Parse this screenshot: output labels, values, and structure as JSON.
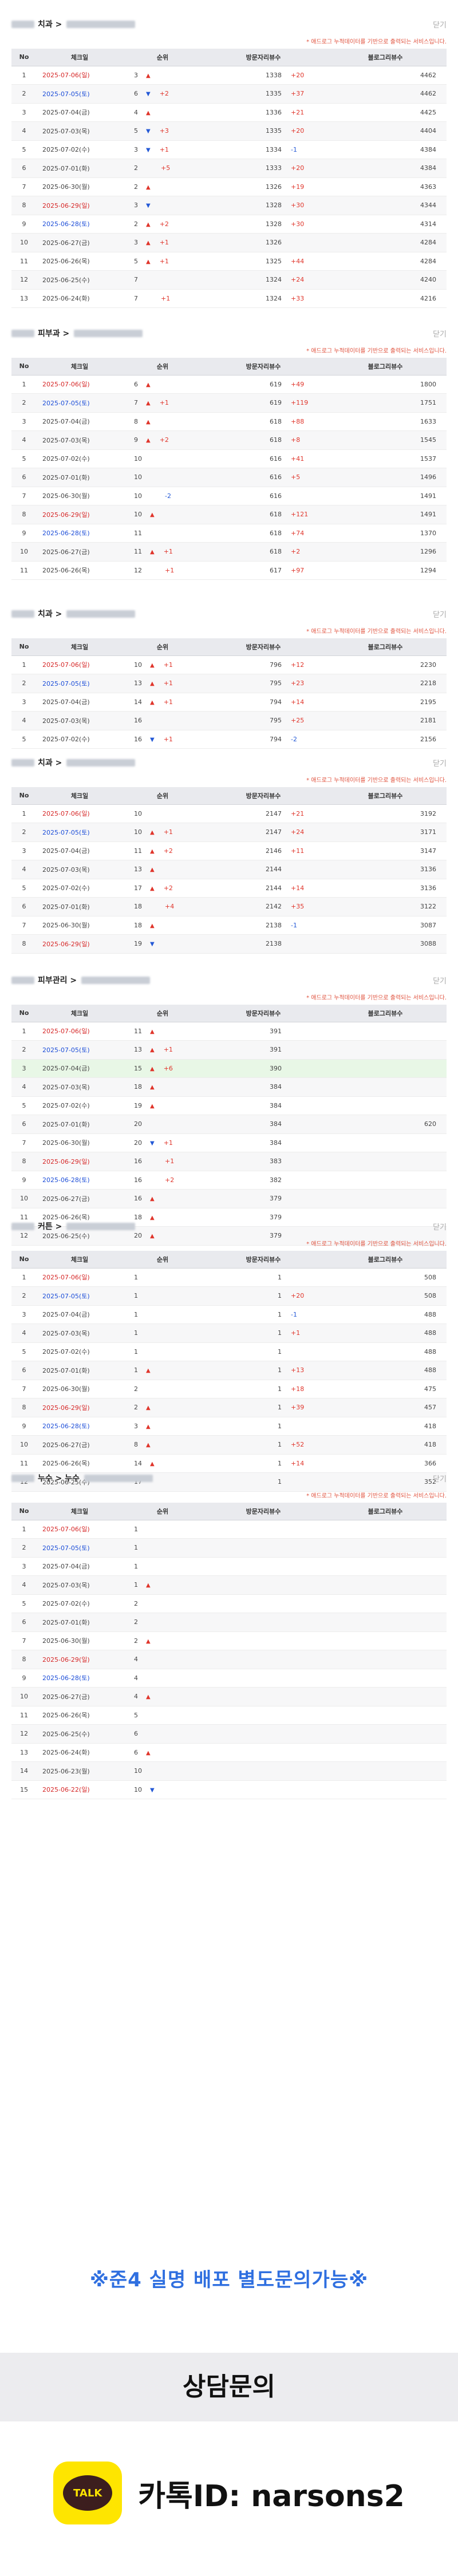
{
  "common": {
    "close": "닫기",
    "note": "* 애드로그 누적데이터를 기반으로 출력되는 서비스입니다.",
    "headers": [
      "No",
      "체크일",
      "순위",
      "방문자리뷰수",
      "블로그리뷰수"
    ]
  },
  "panels": [
    {
      "title_suffix": "치과 >",
      "rows": [
        [
          "1",
          "2025-07-06(일)",
          "3",
          "up",
          "",
          "1338",
          "+20",
          "4462"
        ],
        [
          "2",
          "2025-07-05(토)",
          "6",
          "dn",
          "+2",
          "1335",
          "+37",
          "4462"
        ],
        [
          "3",
          "2025-07-04(금)",
          "4",
          "up",
          "",
          "1336",
          "+21",
          "4425"
        ],
        [
          "4",
          "2025-07-03(목)",
          "5",
          "dn",
          "+3",
          "1335",
          "+20",
          "4404"
        ],
        [
          "5",
          "2025-07-02(수)",
          "3",
          "dn",
          "+1",
          "1334",
          "-1",
          "4384"
        ],
        [
          "6",
          "2025-07-01(화)",
          "2",
          "",
          "+5",
          "1333",
          "+20",
          "4384"
        ],
        [
          "7",
          "2025-06-30(월)",
          "2",
          "up",
          "",
          "1326",
          "+19",
          "4363"
        ],
        [
          "8",
          "2025-06-29(일)",
          "3",
          "dn",
          "",
          "1328",
          "+30",
          "4344"
        ],
        [
          "9",
          "2025-06-28(토)",
          "2",
          "up",
          "+2",
          "1328",
          "+30",
          "4314"
        ],
        [
          "10",
          "2025-06-27(금)",
          "3",
          "up",
          "+1",
          "1326",
          "",
          "4284"
        ],
        [
          "11",
          "2025-06-26(목)",
          "5",
          "up",
          "+1",
          "1325",
          "+44",
          "4284"
        ],
        [
          "12",
          "2025-06-25(수)",
          "7",
          "",
          "",
          "1324",
          "+24",
          "4240"
        ],
        [
          "13",
          "2025-06-24(화)",
          "7",
          "",
          "+1",
          "1324",
          "+33",
          "4216"
        ]
      ]
    },
    {
      "title_suffix": "피부과 >",
      "rows": [
        [
          "1",
          "2025-07-06(일)",
          "6",
          "up",
          "",
          "619",
          "+49",
          "1800"
        ],
        [
          "2",
          "2025-07-05(토)",
          "7",
          "up",
          "+1",
          "619",
          "+119",
          "1751"
        ],
        [
          "3",
          "2025-07-04(금)",
          "8",
          "up",
          "",
          "618",
          "+88",
          "1633"
        ],
        [
          "4",
          "2025-07-03(목)",
          "9",
          "up",
          "+2",
          "618",
          "+8",
          "1545"
        ],
        [
          "5",
          "2025-07-02(수)",
          "10",
          "",
          "",
          "616",
          "+41",
          "1537"
        ],
        [
          "6",
          "2025-07-01(화)",
          "10",
          "",
          "",
          "616",
          "+5",
          "1496"
        ],
        [
          "7",
          "2025-06-30(월)",
          "10",
          "",
          "-2",
          "616",
          "",
          "1491"
        ],
        [
          "8",
          "2025-06-29(일)",
          "10",
          "up",
          "",
          "618",
          "+121",
          "1491"
        ],
        [
          "9",
          "2025-06-28(토)",
          "11",
          "",
          "",
          "618",
          "+74",
          "1370"
        ],
        [
          "10",
          "2025-06-27(금)",
          "11",
          "up",
          "+1",
          "618",
          "+2",
          "1296"
        ],
        [
          "11",
          "2025-06-26(목)",
          "12",
          "",
          "+1",
          "617",
          "+97",
          "1294"
        ]
      ]
    },
    {
      "title_suffix": "치과 >",
      "rows": [
        [
          "1",
          "2025-07-06(일)",
          "10",
          "up",
          "+1",
          "796",
          "+12",
          "2230"
        ],
        [
          "2",
          "2025-07-05(토)",
          "13",
          "up",
          "+1",
          "795",
          "+23",
          "2218"
        ],
        [
          "3",
          "2025-07-04(금)",
          "14",
          "up",
          "+1",
          "794",
          "+14",
          "2195"
        ],
        [
          "4",
          "2025-07-03(목)",
          "16",
          "",
          "",
          "795",
          "+25",
          "2181"
        ],
        [
          "5",
          "2025-07-02(수)",
          "16",
          "dn",
          "+1",
          "794",
          "-2",
          "2156"
        ]
      ]
    },
    {
      "title_suffix": "치과 >",
      "rows": [
        [
          "1",
          "2025-07-06(일)",
          "10",
          "",
          "",
          "2147",
          "+21",
          "3192"
        ],
        [
          "2",
          "2025-07-05(토)",
          "10",
          "up",
          "+1",
          "2147",
          "+24",
          "3171"
        ],
        [
          "3",
          "2025-07-04(금)",
          "11",
          "up",
          "+2",
          "2146",
          "+11",
          "3147"
        ],
        [
          "4",
          "2025-07-03(목)",
          "13",
          "up",
          "",
          "2144",
          "",
          "3136"
        ],
        [
          "5",
          "2025-07-02(수)",
          "17",
          "up",
          "+2",
          "2144",
          "+14",
          "3136"
        ],
        [
          "6",
          "2025-07-01(화)",
          "18",
          "",
          "+4",
          "2142",
          "+35",
          "3122"
        ],
        [
          "7",
          "2025-06-30(월)",
          "18",
          "up",
          "",
          "2138",
          "-1",
          "3087"
        ],
        [
          "8",
          "2025-06-29(일)",
          "19",
          "dn",
          "",
          "2138",
          "",
          "3088"
        ]
      ]
    },
    {
      "title_suffix": "피부관리 >",
      "rows": [
        [
          "1",
          "2025-07-06(일)",
          "11",
          "up",
          "",
          "391",
          "",
          ""
        ],
        [
          "2",
          "2025-07-05(토)",
          "13",
          "up",
          "+1",
          "391",
          "",
          ""
        ],
        [
          "3",
          "2025-07-04(금)",
          "15",
          "up",
          "+6",
          "390",
          "",
          ""
        ],
        [
          "4",
          "2025-07-03(목)",
          "18",
          "up",
          "",
          "384",
          "",
          ""
        ],
        [
          "5",
          "2025-07-02(수)",
          "19",
          "up",
          "",
          "384",
          "",
          ""
        ],
        [
          "6",
          "2025-07-01(화)",
          "20",
          "",
          "",
          "384",
          "",
          "620"
        ],
        [
          "7",
          "2025-06-30(월)",
          "20",
          "dn",
          "+1",
          "384",
          "",
          ""
        ],
        [
          "8",
          "2025-06-29(일)",
          "16",
          "",
          "+1",
          "383",
          "",
          ""
        ],
        [
          "9",
          "2025-06-28(토)",
          "16",
          "",
          "+2",
          "382",
          "",
          ""
        ],
        [
          "10",
          "2025-06-27(금)",
          "16",
          "up",
          "",
          "379",
          "",
          ""
        ],
        [
          "11",
          "2025-06-26(목)",
          "18",
          "up",
          "",
          "379",
          "",
          ""
        ],
        [
          "12",
          "2025-06-25(수)",
          "20",
          "up",
          "",
          "379",
          "",
          ""
        ]
      ]
    },
    {
      "title_suffix": "커튼 >",
      "rows": [
        [
          "1",
          "2025-07-06(일)",
          "1",
          "",
          "",
          "1",
          "",
          "508"
        ],
        [
          "2",
          "2025-07-05(토)",
          "1",
          "",
          "",
          "1",
          "+20",
          "508"
        ],
        [
          "3",
          "2025-07-04(금)",
          "1",
          "",
          "",
          "1",
          "-1",
          "488"
        ],
        [
          "4",
          "2025-07-03(목)",
          "1",
          "",
          "",
          "1",
          "+1",
          "488"
        ],
        [
          "5",
          "2025-07-02(수)",
          "1",
          "",
          "",
          "1",
          "",
          "488"
        ],
        [
          "6",
          "2025-07-01(화)",
          "1",
          "up",
          "",
          "1",
          "+13",
          "488"
        ],
        [
          "7",
          "2025-06-30(월)",
          "2",
          "",
          "",
          "1",
          "+18",
          "475"
        ],
        [
          "8",
          "2025-06-29(일)",
          "2",
          "up",
          "",
          "1",
          "+39",
          "457"
        ],
        [
          "9",
          "2025-06-28(토)",
          "3",
          "up",
          "",
          "1",
          "",
          "418"
        ],
        [
          "10",
          "2025-06-27(금)",
          "8",
          "up",
          "",
          "1",
          "+52",
          "418"
        ],
        [
          "11",
          "2025-06-26(목)",
          "14",
          "up",
          "",
          "1",
          "+14",
          "366"
        ],
        [
          "12",
          "2025-06-25(수)",
          "17",
          "",
          "",
          "1",
          "",
          "352"
        ]
      ]
    },
    {
      "title_suffix": "누수 > 누수",
      "rows": [
        [
          "1",
          "2025-07-06(일)",
          "1",
          "",
          "",
          "",
          "",
          ""
        ],
        [
          "2",
          "2025-07-05(토)",
          "1",
          "",
          "",
          "",
          "",
          ""
        ],
        [
          "3",
          "2025-07-04(금)",
          "1",
          "",
          "",
          "",
          "",
          ""
        ],
        [
          "4",
          "2025-07-03(목)",
          "1",
          "up",
          "",
          "",
          "",
          ""
        ],
        [
          "5",
          "2025-07-02(수)",
          "2",
          "",
          "",
          "",
          "",
          ""
        ],
        [
          "6",
          "2025-07-01(화)",
          "2",
          "",
          "",
          "",
          "",
          ""
        ],
        [
          "7",
          "2025-06-30(월)",
          "2",
          "up",
          "",
          "",
          "",
          ""
        ],
        [
          "8",
          "2025-06-29(일)",
          "4",
          "",
          "",
          "",
          "",
          ""
        ],
        [
          "9",
          "2025-06-28(토)",
          "4",
          "",
          "",
          "",
          "",
          ""
        ],
        [
          "10",
          "2025-06-27(금)",
          "4",
          "up",
          "",
          "",
          "",
          ""
        ],
        [
          "11",
          "2025-06-26(목)",
          "5",
          "",
          "",
          "",
          "",
          ""
        ],
        [
          "12",
          "2025-06-25(수)",
          "6",
          "",
          "",
          "",
          "",
          ""
        ],
        [
          "13",
          "2025-06-24(화)",
          "6",
          "up",
          "",
          "",
          "",
          ""
        ],
        [
          "14",
          "2025-06-23(월)",
          "10",
          "",
          "",
          "",
          "",
          ""
        ],
        [
          "15",
          "2025-06-22(일)",
          "10",
          "dn",
          "",
          "",
          "",
          ""
        ]
      ]
    }
  ],
  "banners": {
    "promo": "※준4 실명 배포 별도문의가능※",
    "consult": "상담문의",
    "talk_icon": "TALK",
    "kakao_id": "카톡ID: narsons2"
  },
  "colors": {
    "up": "#e0352b",
    "down": "#2459d6",
    "accent": "#2f6fe0",
    "kakao": "#fee500"
  }
}
